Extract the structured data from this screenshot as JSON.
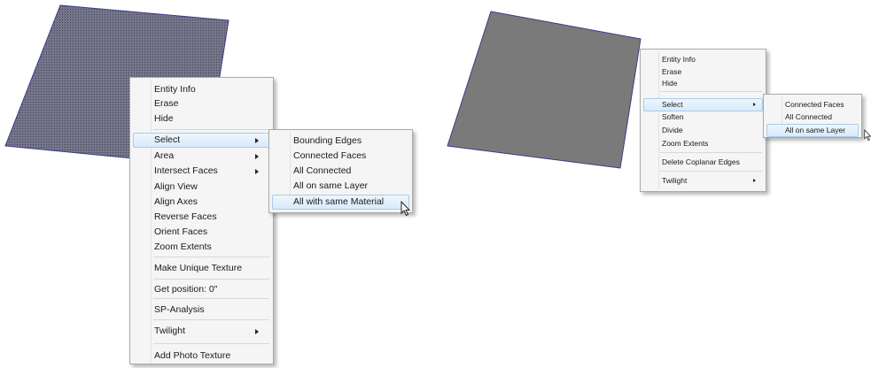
{
  "left": {
    "context_menu": [
      {
        "label": "Entity Info"
      },
      {
        "label": "Erase"
      },
      {
        "label": "Hide"
      },
      {
        "separator": true
      },
      {
        "label": "Select",
        "submenu": true,
        "highlighted": true
      },
      {
        "label": "Area",
        "submenu": true
      },
      {
        "label": "Intersect Faces",
        "submenu": true
      },
      {
        "label": "Align View"
      },
      {
        "label": "Align Axes"
      },
      {
        "label": "Reverse Faces"
      },
      {
        "label": "Orient Faces"
      },
      {
        "label": "Zoom Extents"
      },
      {
        "separator": true
      },
      {
        "label": "Make Unique Texture"
      },
      {
        "separator": true
      },
      {
        "label": "Get position: 0\""
      },
      {
        "separator": true
      },
      {
        "label": "SP-Analysis"
      },
      {
        "separator": true
      },
      {
        "label": "Twilight",
        "submenu": true
      },
      {
        "separator": true
      },
      {
        "label": "Add Photo Texture"
      }
    ],
    "select_submenu": [
      {
        "label": "Bounding Edges"
      },
      {
        "label": "Connected Faces"
      },
      {
        "label": "All Connected"
      },
      {
        "label": "All on same Layer"
      },
      {
        "label": "All with same Material",
        "highlighted": true
      }
    ]
  },
  "right": {
    "context_menu": [
      {
        "label": "Entity Info"
      },
      {
        "label": "Erase"
      },
      {
        "label": "Hide"
      },
      {
        "separator": true
      },
      {
        "label": "Select",
        "submenu": true,
        "highlighted": true
      },
      {
        "label": "Soften"
      },
      {
        "label": "Divide"
      },
      {
        "label": "Zoom Extents"
      },
      {
        "separator": true
      },
      {
        "label": "Delete Coplanar Edges"
      },
      {
        "separator": true
      },
      {
        "label": "Twilight",
        "submenu": true
      }
    ],
    "select_submenu": [
      {
        "label": "Connected Faces"
      },
      {
        "label": "All Connected"
      },
      {
        "label": "All on same Layer",
        "highlighted": true
      }
    ]
  },
  "colors": {
    "face_textured": "#6f6f7b",
    "face_plain": "#7a7a7a",
    "face_edge": "#3b3b8c",
    "highlight": "#d8eafb"
  },
  "icons": [
    "submenu-arrow-icon",
    "mouse-cursor-icon"
  ]
}
